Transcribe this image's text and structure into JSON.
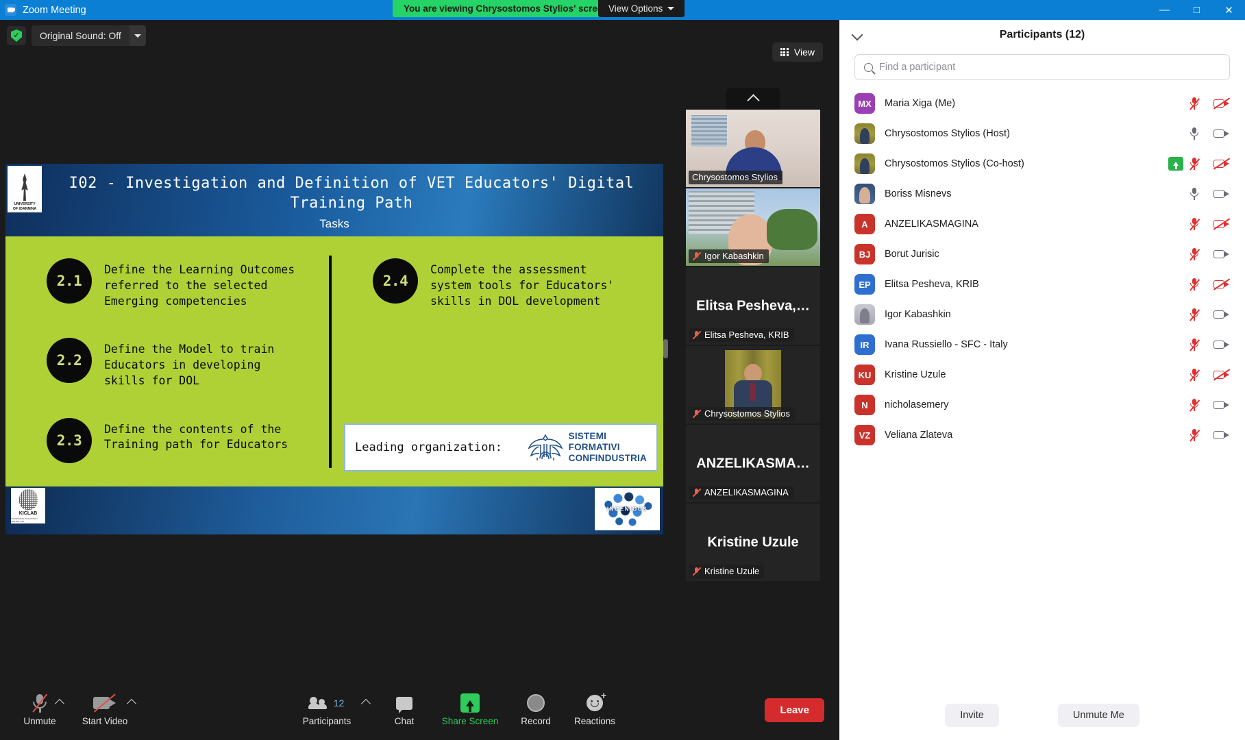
{
  "window": {
    "title": "Zoom Meeting",
    "app_icon": "video-camera-icon",
    "minimize": "—",
    "maximize": "□",
    "close": "✕"
  },
  "share_banner": {
    "text": "You are viewing Chrysostomos Stylios' screen",
    "view_options_label": "View Options",
    "color": "#25d366"
  },
  "toolbar_top": {
    "original_sound_label": "Original Sound: Off",
    "shield_icon": "security-shield-icon",
    "view_button_label": "View"
  },
  "slide": {
    "title": "I02 - Investigation and Definition of VET Educators' Digital Training Path",
    "subtitle": "Tasks",
    "university_logo_line1": "UNIVERSITY",
    "university_logo_line2": "OF IOANNINA",
    "tasks_left": [
      {
        "num": "2.1",
        "text": "Define the Learning Outcomes\nreferred to the selected\nEmerging competencies"
      },
      {
        "num": "2.2",
        "text": "Define the Model to train\nEducators in developing\nskills for DOL"
      },
      {
        "num": "2.3",
        "text": "Define the contents of the\nTraining path for Educators"
      }
    ],
    "tasks_right": [
      {
        "num": "2.4",
        "text": "Complete the assessment\nsystem tools for Educators'\nskills in DOL development"
      }
    ],
    "leading_org_label": "Leading organization:",
    "leading_org_name_line1": "SISTEMI",
    "leading_org_name_line2": "FORMATIVI",
    "leading_org_name_line3": "CONFINDUSTRIA",
    "footer_logo_left_title": "KICLAB",
    "footer_logo_left_sub": "KNOWLEDGE INNOVATION CENTER LAB",
    "footer_logo_right": "INGENIOUS",
    "colors": {
      "body_green": "#b0d136",
      "header_blue": "#1a5c9e",
      "org_text_blue": "#1f4e87"
    }
  },
  "thumbnails": [
    {
      "name": "Chrysostomos Stylios",
      "display": "",
      "kind": "office-photo",
      "active": true,
      "muted": false
    },
    {
      "name": "Igor Kabashkin",
      "display": "",
      "kind": "building-photo",
      "active": false,
      "muted": true
    },
    {
      "name": "Elitsa Pesheva, KRIB",
      "display": "Elitsa  Pesheva,…",
      "kind": "text",
      "active": false,
      "muted": true
    },
    {
      "name": "Chrysostomos Stylios",
      "display": "",
      "kind": "podium-photo",
      "active": false,
      "muted": true
    },
    {
      "name": "ANZELIKASMAGINA",
      "display": "ANZELIKASMA…",
      "kind": "text",
      "active": false,
      "muted": true
    },
    {
      "name": "Kristine Uzule",
      "display": "Kristine Uzule",
      "kind": "text",
      "active": false,
      "muted": true
    }
  ],
  "bottom_bar": {
    "controls": [
      {
        "id": "mute",
        "label": "Unmute",
        "icon": "mic-off-icon",
        "has_arrow": true,
        "green": false
      },
      {
        "id": "video",
        "label": "Start Video",
        "icon": "camera-off-icon",
        "has_arrow": true,
        "green": false
      },
      {
        "id": "participants",
        "label": "Participants",
        "icon": "people-icon",
        "has_arrow": true,
        "green": false,
        "count": "12"
      },
      {
        "id": "chat",
        "label": "Chat",
        "icon": "chat-bubble-icon",
        "has_arrow": false,
        "green": false
      },
      {
        "id": "share",
        "label": "Share Screen",
        "icon": "share-screen-icon",
        "has_arrow": false,
        "green": true
      },
      {
        "id": "record",
        "label": "Record",
        "icon": "record-circle-icon",
        "has_arrow": false,
        "green": false
      },
      {
        "id": "reactions",
        "label": "Reactions",
        "icon": "reactions-icon",
        "has_arrow": false,
        "green": false
      }
    ],
    "leave_label": "Leave",
    "leave_color": "#d42c2c"
  },
  "participants_panel": {
    "title": "Participants (12)",
    "search_placeholder": "Find a participant",
    "search_value": "",
    "collapse_icon": "chevron-down-icon",
    "rows": [
      {
        "name": "Maria Xiga (Me)",
        "initials": "MX",
        "avatar_color": "#9b3fb5",
        "avatar_kind": "initials",
        "mic": "off",
        "cam": "off",
        "host_badge": false
      },
      {
        "name": "Chrysostomos Stylios (Host)",
        "initials": "",
        "avatar_color": "",
        "avatar_kind": "photo-a",
        "mic": "on",
        "cam": "on",
        "host_badge": false
      },
      {
        "name": "Chrysostomos Stylios (Co-host)",
        "initials": "",
        "avatar_color": "",
        "avatar_kind": "photo-a",
        "mic": "off",
        "cam": "off",
        "host_badge": true
      },
      {
        "name": "Boriss Misnevs",
        "initials": "",
        "avatar_color": "",
        "avatar_kind": "photo-b",
        "mic": "on",
        "cam": "on",
        "host_badge": false
      },
      {
        "name": "ANZELIKASMAGINA",
        "initials": "A",
        "avatar_color": "#c9332b",
        "avatar_kind": "initials",
        "mic": "off",
        "cam": "off",
        "host_badge": false
      },
      {
        "name": "Borut Jurisic",
        "initials": "BJ",
        "avatar_color": "#c9332b",
        "avatar_kind": "initials",
        "mic": "off",
        "cam": "on",
        "host_badge": false
      },
      {
        "name": "Elitsa Pesheva, KRIB",
        "initials": "EP",
        "avatar_color": "#2f6fd0",
        "avatar_kind": "initials",
        "mic": "off",
        "cam": "off",
        "host_badge": false
      },
      {
        "name": "Igor Kabashkin",
        "initials": "",
        "avatar_color": "",
        "avatar_kind": "photo-c",
        "mic": "off",
        "cam": "on",
        "host_badge": false
      },
      {
        "name": "Ivana Russiello - SFC - Italy",
        "initials": "IR",
        "avatar_color": "#2f6fd0",
        "avatar_kind": "initials",
        "mic": "off",
        "cam": "on",
        "host_badge": false
      },
      {
        "name": "Kristine Uzule",
        "initials": "KU",
        "avatar_color": "#c9332b",
        "avatar_kind": "initials",
        "mic": "off",
        "cam": "off",
        "host_badge": false
      },
      {
        "name": "nicholasemery",
        "initials": "N",
        "avatar_color": "#c9332b",
        "avatar_kind": "initials",
        "mic": "off",
        "cam": "on",
        "host_badge": false
      },
      {
        "name": "Veliana Zlateva",
        "initials": "VZ",
        "avatar_color": "#c9332b",
        "avatar_kind": "initials",
        "mic": "off",
        "cam": "on",
        "host_badge": false
      }
    ],
    "invite_label": "Invite",
    "unmute_me_label": "Unmute Me"
  }
}
